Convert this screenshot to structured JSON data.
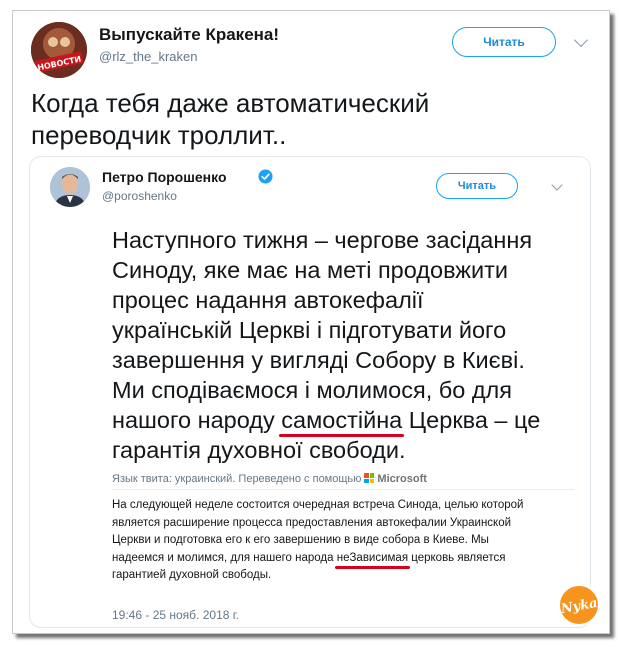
{
  "outer_tweet": {
    "display_name": "Выпускайте Кракена!",
    "handle": "@rlz_the_kraken",
    "follow_label": "Читать",
    "text_lines": [
      "Когда тебя даже автоматический",
      "переводчик троллит.."
    ],
    "avatar_label": "НОВОСТИ"
  },
  "quoted_tweet": {
    "display_name": "Петро Порошенко",
    "handle": "@poroshenko",
    "follow_label": "Читать",
    "text_lines": [
      "Наступного тижня – чергове засідання",
      "Синоду, яке має на меті продовжити",
      "процес надання автокефалії",
      "українській Церкві і підготувати його",
      "завершення у вигляді Собору в Києві.",
      "Ми сподіваємося і молимося, бо для"
    ],
    "line7_before": "нашого народу ",
    "line7_highlight": "самостійна",
    "line7_after": " Церква – це",
    "line8": "гарантія духовної свободи.",
    "translation_note": "Язык твита: украинский. Переведено с помощью",
    "translation_brand": "Microsoft",
    "translated_lines": [
      "На следующей неделе состоится очередная встреча Синода, целью которой",
      "является расширение процесса предоставления автокефалии Украинской",
      "Церкви и подготовка его к его завершению в виде собора в Киеве. Мы"
    ],
    "translated_line4_before": "надеемся и молимся, для нашего народа ",
    "translated_line4_highlight": "неЗависимая",
    "translated_line4_after": " церковь является",
    "translated_line5": "гарантией духовной свободы.",
    "timestamp": "19:46 - 25 нояб. 2018 г."
  },
  "colors": {
    "accent": "#1da1f2",
    "highlight_underline": "#d6001c",
    "watermark": "#f7941d"
  },
  "icons": {
    "verified": "verified-badge-icon",
    "menu": "chevron-down-icon"
  },
  "watermark_text": "Nyka"
}
